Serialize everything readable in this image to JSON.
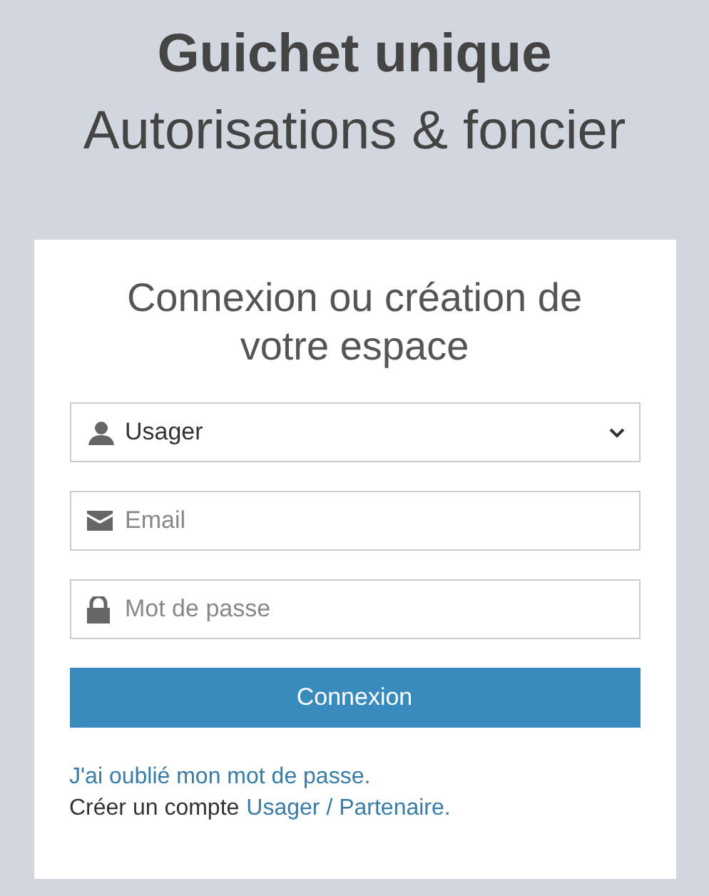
{
  "header": {
    "title": "Guichet unique",
    "subtitle": "Autorisations & foncier"
  },
  "card": {
    "heading": "Connexion ou création de votre espace",
    "fields": [
      {
        "kind": "select",
        "value": "Usager"
      },
      {
        "kind": "email",
        "placeholder": "Email"
      },
      {
        "kind": "password",
        "placeholder": "Mot de passe"
      }
    ],
    "submit": "Connexion",
    "forgot_link": "J'ai oublié mon mot de passe.",
    "create_text": "Créer un compte",
    "create_link": "Usager / Partenaire."
  }
}
